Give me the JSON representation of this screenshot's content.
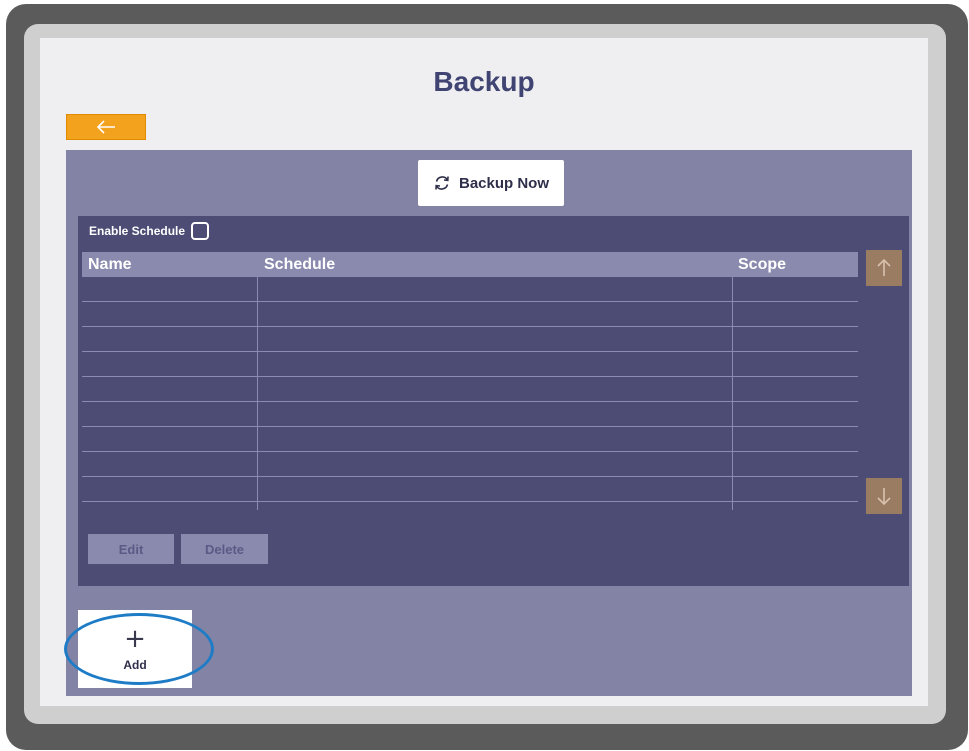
{
  "page": {
    "title": "Backup"
  },
  "toolbar": {
    "back_icon": "arrow-left-icon",
    "backup_now_label": "Backup Now",
    "backup_now_icon": "sync-icon"
  },
  "schedule": {
    "enable_label": "Enable Schedule",
    "enabled": false,
    "columns": [
      "Name",
      "Schedule",
      "Scope"
    ],
    "rows": [
      {
        "name": "",
        "schedule": "",
        "scope": ""
      },
      {
        "name": "",
        "schedule": "",
        "scope": ""
      },
      {
        "name": "",
        "schedule": "",
        "scope": ""
      },
      {
        "name": "",
        "schedule": "",
        "scope": ""
      },
      {
        "name": "",
        "schedule": "",
        "scope": ""
      },
      {
        "name": "",
        "schedule": "",
        "scope": ""
      },
      {
        "name": "",
        "schedule": "",
        "scope": ""
      },
      {
        "name": "",
        "schedule": "",
        "scope": ""
      },
      {
        "name": "",
        "schedule": "",
        "scope": ""
      }
    ],
    "edit_label": "Edit",
    "delete_label": "Delete"
  },
  "add": {
    "label": "Add",
    "icon": "plus-icon"
  },
  "colors": {
    "accent": "#f2a21d",
    "title": "#3f4473",
    "panel": "#8283a5",
    "table_bg": "#4c4c75",
    "highlight": "#1e7cc6"
  }
}
